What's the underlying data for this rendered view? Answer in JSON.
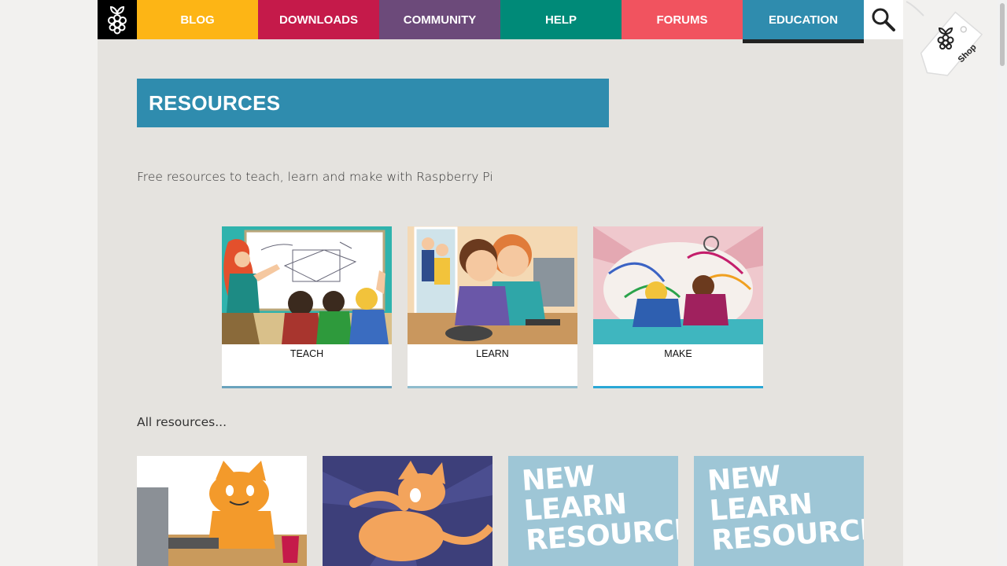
{
  "nav": {
    "items": [
      {
        "label": "BLOG",
        "color": "#fdb515"
      },
      {
        "label": "DOWNLOADS",
        "color": "#c51a4a"
      },
      {
        "label": "COMMUNITY",
        "color": "#6c4a7a"
      },
      {
        "label": "HELP",
        "color": "#008a78"
      },
      {
        "label": "FORUMS",
        "color": "#f1535f"
      },
      {
        "label": "EDUCATION",
        "color": "#2f8cae"
      }
    ],
    "shop_label": "Shop"
  },
  "page": {
    "title": "RESOURCES",
    "intro": "Free resources to teach, learn and make with Raspberry Pi",
    "all_resources": "All resources..."
  },
  "cards": [
    {
      "label": "TEACH",
      "bar_color": "#6aa3bd"
    },
    {
      "label": "LEARN",
      "bar_color": "#8fbccd"
    },
    {
      "label": "MAKE",
      "bar_color": "#2aa7d6"
    }
  ],
  "tiles": {
    "new_label": [
      "NEW",
      "LEARN",
      "RESOURCE"
    ]
  }
}
